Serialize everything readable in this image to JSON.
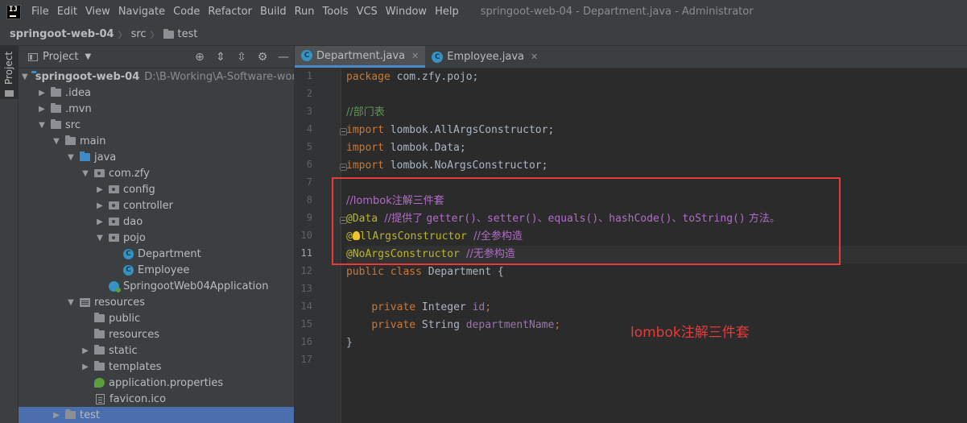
{
  "menubar": {
    "items": [
      "File",
      "Edit",
      "View",
      "Navigate",
      "Code",
      "Refactor",
      "Build",
      "Run",
      "Tools",
      "VCS",
      "Window",
      "Help"
    ],
    "window_title": "springoot-web-04 - Department.java - Administrator"
  },
  "breadcrumb": {
    "project": "springoot-web-04",
    "src": "src",
    "test": "test"
  },
  "toolstrip": {
    "label": "Project"
  },
  "project_panel": {
    "title": "Project",
    "tree": {
      "root": {
        "name": "springoot-web-04",
        "path": "D:\\B-Working\\A-Software-work\\"
      },
      "idea": ".idea",
      "mvn": ".mvn",
      "src": "src",
      "main": "main",
      "java": "java",
      "comzfy": "com.zfy",
      "config": "config",
      "controller": "controller",
      "dao": "dao",
      "pojo": "pojo",
      "department": "Department",
      "employee": "Employee",
      "app": "SpringootWeb04Application",
      "resources": "resources",
      "public": "public",
      "resources2": "resources",
      "static": "static",
      "templates": "templates",
      "app_props": "application.properties",
      "favicon": "favicon.ico",
      "test": "test"
    }
  },
  "tabs": {
    "department": "Department.java",
    "employee": "Employee.java"
  },
  "code": {
    "l1_kw": "package",
    "l1_rest": " com.zfy.pojo;",
    "l3": "//部门表",
    "import_kw": "import",
    "l4_rest": " lombok.AllArgsConstructor;",
    "l5_rest": " lombok.Data;",
    "l6_rest": " lombok.NoArgsConstructor;",
    "l8": "//lombok注解三件套",
    "l9_an": "@Data",
    "l9_c1": "  //提供了 ",
    "l9_c2": "getter()、setter()、equals()、hashCode()、toString()",
    "l9_c3": " 方法。",
    "l10_an_a": "@",
    "l10_an_b": "llArgsConstructor",
    "l10_cm": "  //全参构造",
    "l11_an": "@NoArgsConstructor",
    "l11_cm": "  //无参构造",
    "l12_kw": "public class",
    "l12_rest": " Department {",
    "private_kw": "private",
    "l14_type": " Integer ",
    "l14_field": "id",
    "l15_type": " String ",
    "l15_field": "departmentName",
    "semicolon": ";",
    "l16": "}"
  },
  "line_numbers": [
    "1",
    "2",
    "3",
    "4",
    "5",
    "6",
    "7",
    "8",
    "9",
    "10",
    "11",
    "12",
    "13",
    "14",
    "15",
    "16",
    "17"
  ],
  "annotation": "lombok注解三件套",
  "colors": {
    "highlight_box": "#e83a3a",
    "selection": "#4b6eaf",
    "class_icon": "#3592c4"
  }
}
